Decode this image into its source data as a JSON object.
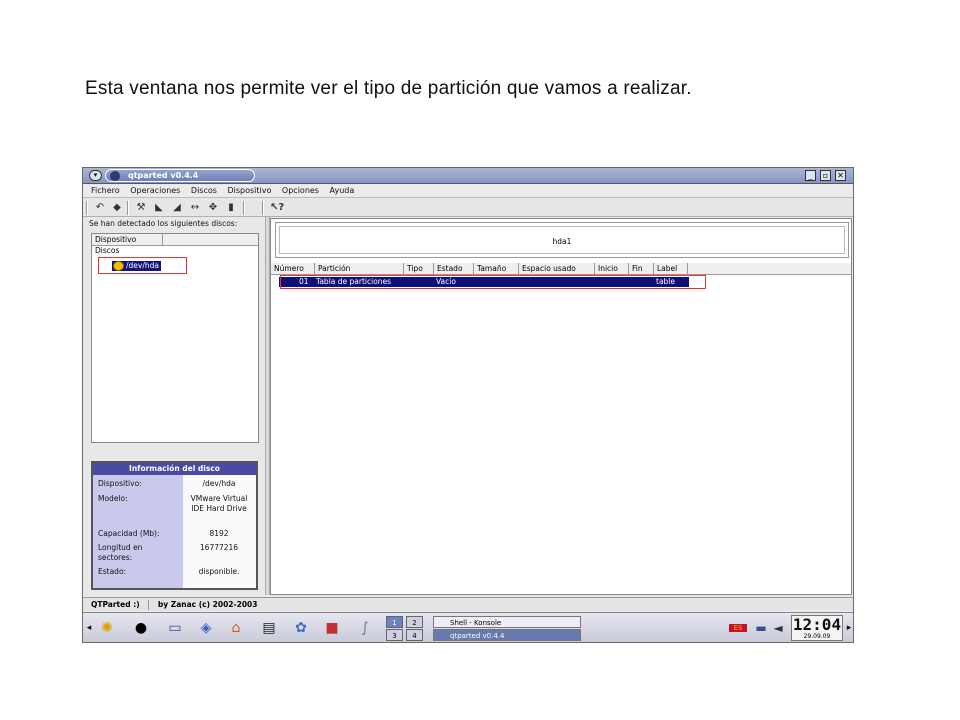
{
  "caption": "Esta ventana nos permite ver el tipo de partición que vamos a realizar.",
  "window": {
    "title": "qtparted v0.4.4",
    "buttons": {
      "minimize": "_",
      "maximize": "▫",
      "close": "✕",
      "menu": "▾"
    }
  },
  "menu": [
    "Fichero",
    "Operaciones",
    "Discos",
    "Dispositivo",
    "Opciones",
    "Ayuda"
  ],
  "toolbar_icons": [
    "undo-icon",
    "commit-icon",
    "wrench-icon",
    "format-icon",
    "eraser-icon",
    "resize-icon",
    "move-icon",
    "trash-icon",
    "whats-this-icon"
  ],
  "left": {
    "detected_label": "Se han detectado los siguientes discos:",
    "tree_header": "Dispositivo",
    "group": "Discos",
    "device": "/dev/hda"
  },
  "info": {
    "title": "Información del disco",
    "rows": [
      {
        "key": "Dispositivo:",
        "value": "/dev/hda"
      },
      {
        "key": "Modelo:",
        "value": "VMware Virtual IDE Hard Drive"
      },
      {
        "key": "Capacidad (Mb):",
        "value": "8192"
      },
      {
        "key": "Longitud en sectores:",
        "value": "16777216"
      },
      {
        "key": "Estado:",
        "value": "disponible."
      }
    ]
  },
  "diskmap": {
    "partition": "hda1"
  },
  "table": {
    "headers": [
      "Número",
      "Partición",
      "Tipo",
      "Estado",
      "Tamaño",
      "Espacio usado",
      "Inicio",
      "Fin",
      "Label"
    ],
    "rows": [
      {
        "numero": "01",
        "particion": "Tabla de particiones",
        "tipo": "",
        "estado": "Vacío",
        "tamano": "",
        "espacio": "",
        "inicio": "",
        "fin": "",
        "label": "table"
      }
    ]
  },
  "statusbar": {
    "app": "QTParted :)",
    "credit": "by Zanac (c) 2002-2003"
  },
  "taskbar": {
    "pagers": [
      "1",
      "2",
      "3",
      "4"
    ],
    "tasks": [
      "Shell - Konsole",
      "qtparted v0.4.4"
    ],
    "clock": "12:04",
    "date": "29.09.09"
  }
}
